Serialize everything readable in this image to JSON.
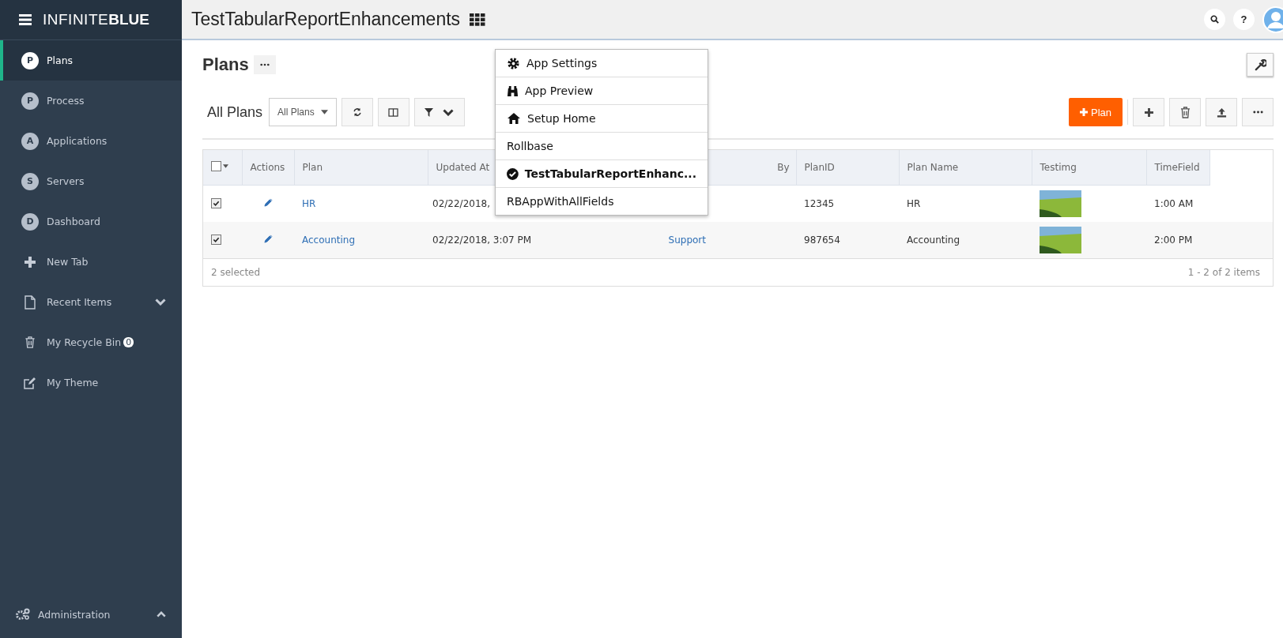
{
  "brand": {
    "light": "INFINITE",
    "bold": "BLUE"
  },
  "app_title": "TestTabularReportEnhancements",
  "header_buttons": [
    {
      "kind": "search"
    },
    {
      "kind": "help",
      "label": "?"
    }
  ],
  "sidebar": {
    "items": [
      {
        "kind": "letter",
        "letter": "P",
        "label": "Plans",
        "selected": true
      },
      {
        "kind": "letter",
        "letter": "P",
        "label": "Process",
        "selected": false
      },
      {
        "kind": "letter",
        "letter": "A",
        "label": "Applications",
        "selected": false
      },
      {
        "kind": "letter",
        "letter": "S",
        "label": "Servers",
        "selected": false
      },
      {
        "kind": "letter",
        "letter": "D",
        "label": "Dashboard",
        "selected": false
      },
      {
        "kind": "new",
        "label": "New Tab",
        "selected": false
      },
      {
        "kind": "recent",
        "label": "Recent Items",
        "selected": false
      },
      {
        "kind": "bin",
        "label": "My Recycle Bin",
        "badge": "0",
        "selected": false
      },
      {
        "kind": "theme",
        "label": "My Theme",
        "selected": false
      }
    ],
    "footer": {
      "label": "Administration"
    }
  },
  "page_title": "Plans",
  "view": {
    "title": "All Plans",
    "selector": "All Plans"
  },
  "new_button": "Plan",
  "app_menu": {
    "items": [
      {
        "kind": "settings",
        "label": "App Settings",
        "selected": false
      },
      {
        "kind": "preview",
        "label": "App Preview",
        "selected": false
      },
      {
        "kind": "home",
        "label": "Setup Home",
        "selected": false
      },
      {
        "kind": "app",
        "label": "Rollbase",
        "selected": false
      },
      {
        "kind": "app",
        "label": "TestTabularReportEnhanc...",
        "selected": true
      },
      {
        "kind": "app",
        "label": "RBAppWithAllFields",
        "selected": false
      }
    ]
  },
  "table": {
    "header_checked": false,
    "columns": [
      "Actions",
      "Plan",
      "Updated At",
      "By",
      "PlanID",
      "Plan Name",
      "Testimg",
      "TimeField"
    ],
    "rows": [
      {
        "checked": true,
        "plan": "HR",
        "updated_at": "02/22/2018,",
        "plan_id": "12345",
        "plan_name": "HR",
        "time": "1:00 AM"
      },
      {
        "checked": true,
        "plan": "Accounting",
        "updated_at": "02/22/2018, 3:07 PM",
        "by": "Support",
        "plan_id": "987654",
        "plan_name": "Accounting",
        "time": "2:00 PM"
      }
    ],
    "selected_count": "2 selected",
    "pager": "1 - 2 of 2 items"
  }
}
